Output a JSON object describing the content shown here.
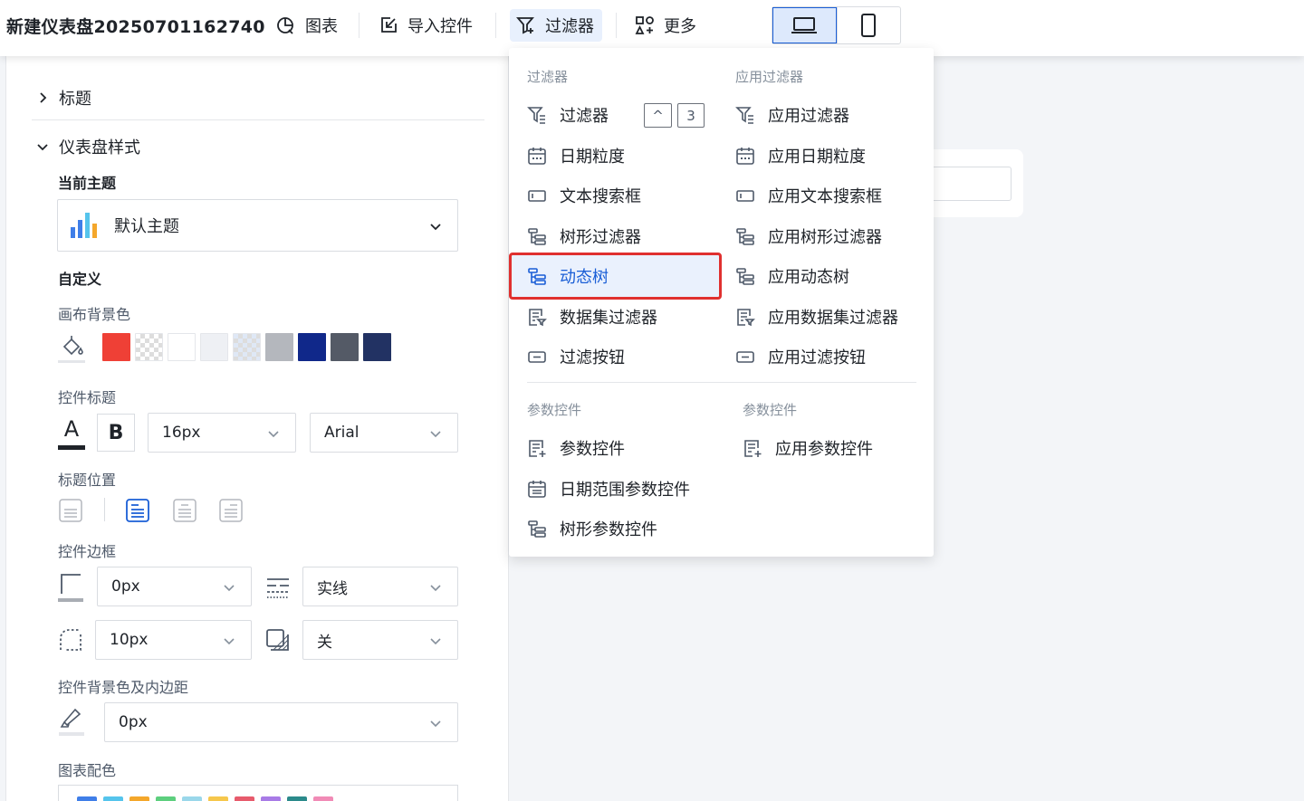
{
  "topbar": {
    "title": "新建仪表盘20250701162740",
    "chart_label": "图表",
    "import_label": "导入控件",
    "filter_label": "过滤器",
    "more_label": "更多"
  },
  "panel": {
    "title_section": "标题",
    "dashboard_style_section": "仪表盘样式",
    "current_theme_label": "当前主题",
    "theme_value": "默认主题",
    "custom_label": "自定义",
    "canvas_bg_label": "画布背景色",
    "widget_title_label": "控件标题",
    "font_size_value": "16px",
    "font_family_value": "Arial",
    "title_position_label": "标题位置",
    "widget_border_label": "控件边框",
    "border_width_value": "0px",
    "border_style_value": "实线",
    "radius_value": "10px",
    "shadow_value": "关",
    "widget_bg_label": "控件背景色及内边距",
    "padding_value": "0px",
    "chart_colors_label": "图表配色",
    "bold_label": "B",
    "font_color_glyph": "A",
    "swatches": [
      "#ef4036",
      "checker",
      "#ffffff",
      "#eef0f4",
      "checker-blue",
      "#b4b7bd",
      "#10288a",
      "#545a66",
      "#223263"
    ],
    "palette": [
      "#3f7ee8",
      "#55c4ec",
      "#f4a72b",
      "#5dcf7e",
      "#9ad7ea",
      "#f6c74c",
      "#e75b6c",
      "#a87be6",
      "#2b8a8b",
      "#f18bb6"
    ]
  },
  "dropdown": {
    "filters_header": "过滤器",
    "apply_filters_header": "应用过滤器",
    "params_header": "参数控件",
    "apply_params_header": "参数控件",
    "stepper_up": "^",
    "stepper_count": "3",
    "left_items": [
      "过滤器",
      "日期粒度",
      "文本搜索框",
      "树形过滤器",
      "动态树",
      "数据集过滤器",
      "过滤按钮"
    ],
    "right_items": [
      "应用过滤器",
      "应用日期粒度",
      "应用文本搜索框",
      "应用树形过滤器",
      "应用动态树",
      "应用数据集过滤器",
      "应用过滤按钮"
    ],
    "param_left_items": [
      "参数控件",
      "日期范围参数控件",
      "树形参数控件"
    ],
    "param_right_items": [
      "应用参数控件"
    ]
  }
}
